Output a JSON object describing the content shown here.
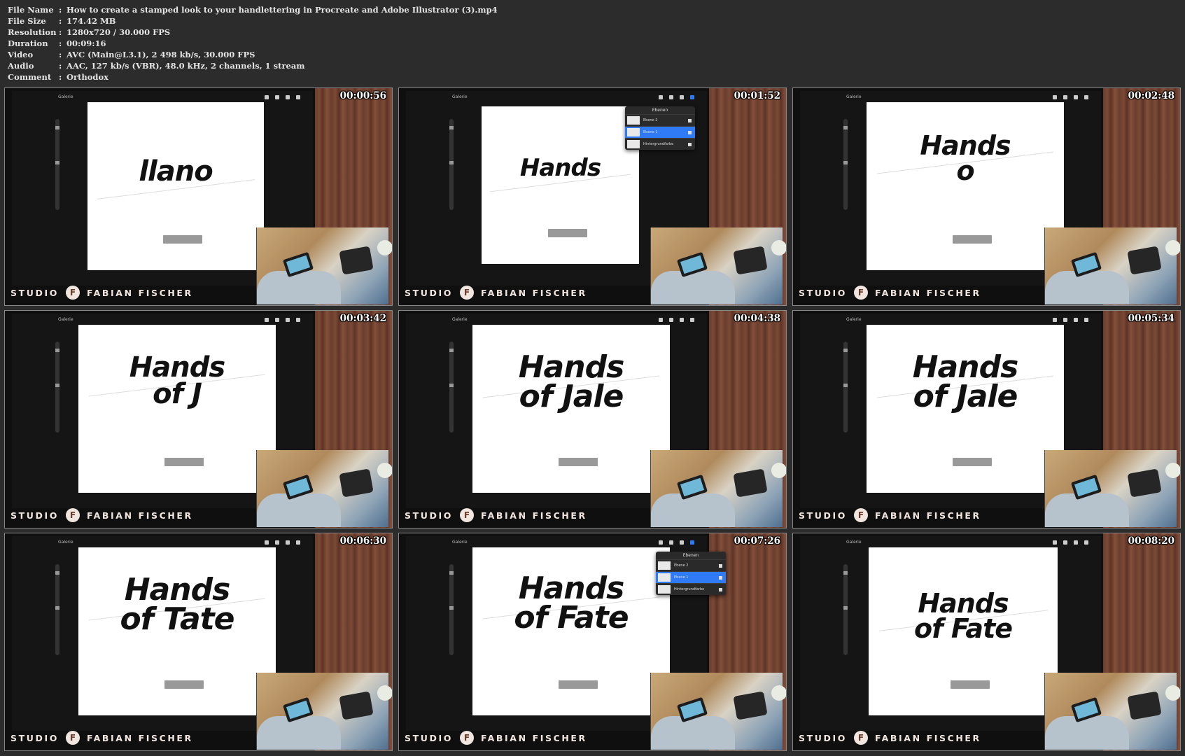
{
  "file_info": [
    {
      "key": "File Name",
      "value": "How to create a stamped look to your handlettering in Procreate and Adobe Illustrator (3).mp4"
    },
    {
      "key": "File Size",
      "value": "174.42 MB"
    },
    {
      "key": "Resolution",
      "value": "1280x720 / 30.000 FPS"
    },
    {
      "key": "Duration",
      "value": "00:09:16"
    },
    {
      "key": "Video",
      "value": "AVC (Main@L3.1), 2 498 kb/s, 30.000 FPS"
    },
    {
      "key": "Audio",
      "value": "AAC, 127 kb/s (VBR), 48.0 kHz, 2 channels, 1 stream"
    },
    {
      "key": "Comment",
      "value": "Orthodox"
    }
  ],
  "separator": ":",
  "branding": {
    "studio": "STUDIO",
    "name": "FABIAN FISCHER"
  },
  "thumbnails": [
    {
      "timestamp": "00:00:56",
      "lettering": "llano",
      "layers_panel": false
    },
    {
      "timestamp": "00:01:52",
      "lettering": "Hands",
      "layers_panel": true
    },
    {
      "timestamp": "00:02:48",
      "lettering": "Hands\no",
      "layers_panel": false
    },
    {
      "timestamp": "00:03:42",
      "lettering": "Hands\nof J",
      "layers_panel": false
    },
    {
      "timestamp": "00:04:38",
      "lettering": "Hands\nof Jale",
      "layers_panel": false
    },
    {
      "timestamp": "00:05:34",
      "lettering": "Hands\nof Jale",
      "layers_panel": false
    },
    {
      "timestamp": "00:06:30",
      "lettering": "Hands\nof Tate",
      "layers_panel": false
    },
    {
      "timestamp": "00:07:26",
      "lettering": "Hands\nof Fate",
      "layers_panel": true
    },
    {
      "timestamp": "00:08:20",
      "lettering": "Hands\nof Fate",
      "layers_panel": false
    }
  ],
  "colors": {
    "wood": "#6a3d2d",
    "accent": "#2f7bf5",
    "background": "#2c2c2c"
  }
}
